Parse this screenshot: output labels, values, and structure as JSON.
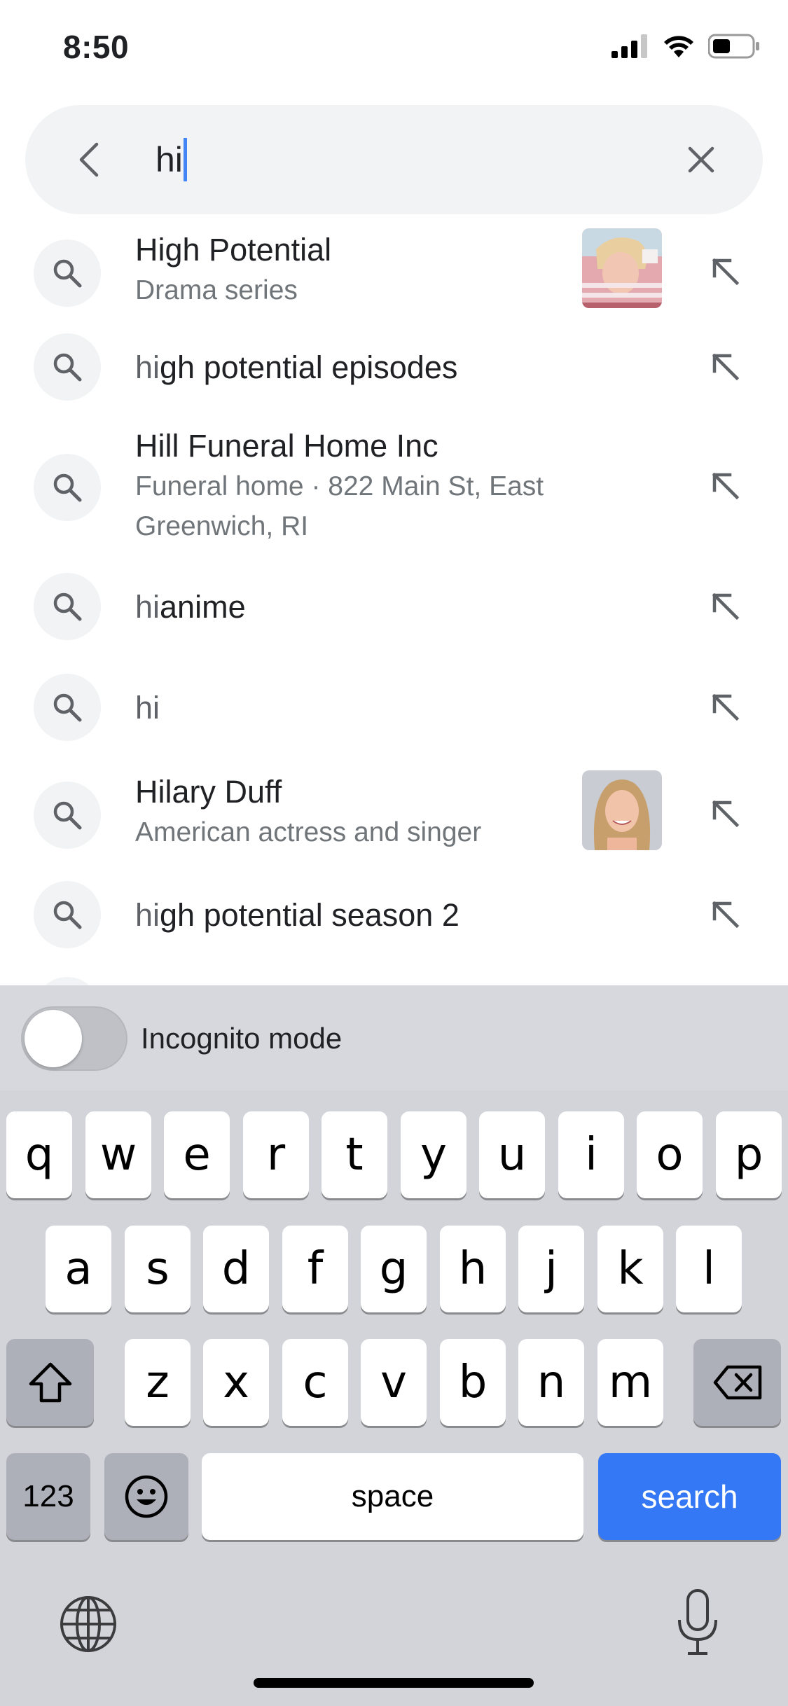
{
  "status_bar": {
    "time": "8:50"
  },
  "search": {
    "query": "hi"
  },
  "suggestions": [
    {
      "prefix": "Hi",
      "rest": "gh Potential",
      "subtitle": "Drama series",
      "has_thumb": true,
      "thumb": "high-potential-poster"
    },
    {
      "prefix": "hi",
      "rest": "gh potential episodes",
      "subtitle": ""
    },
    {
      "prefix": "Hi",
      "rest": "ll Funeral Home Inc",
      "subtitle_line1": "Funeral home · 822 Main St, East",
      "subtitle_line2": "Greenwich, RI"
    },
    {
      "prefix": "hi",
      "rest": "anime",
      "subtitle": ""
    },
    {
      "prefix": "hi",
      "rest": "",
      "subtitle": ""
    },
    {
      "prefix": "Hi",
      "rest": "lary Duff",
      "subtitle": "American actress and singer",
      "has_thumb": true,
      "thumb": "hilary-duff-photo"
    },
    {
      "prefix": "hi",
      "rest": "gh potential season 2",
      "subtitle": ""
    }
  ],
  "incognito": {
    "label": "Incognito mode",
    "enabled": false
  },
  "keyboard": {
    "row1": [
      "q",
      "w",
      "e",
      "r",
      "t",
      "y",
      "u",
      "i",
      "o",
      "p"
    ],
    "row2": [
      "a",
      "s",
      "d",
      "f",
      "g",
      "h",
      "j",
      "k",
      "l"
    ],
    "row3": [
      "z",
      "x",
      "c",
      "v",
      "b",
      "n",
      "m"
    ],
    "numbers_key": "123",
    "space_key": "space",
    "search_key": "search"
  },
  "icons": {
    "back": "chevron-left-icon",
    "clear": "close-icon",
    "suggestion": "search-icon",
    "fill_query": "arrow-up-left-icon",
    "shift": "shift-icon",
    "backspace": "backspace-icon",
    "emoji": "emoji-icon",
    "globe": "globe-icon",
    "mic": "microphone-icon"
  },
  "colors": {
    "accent": "#3478f6",
    "cursor": "#4285f4"
  }
}
